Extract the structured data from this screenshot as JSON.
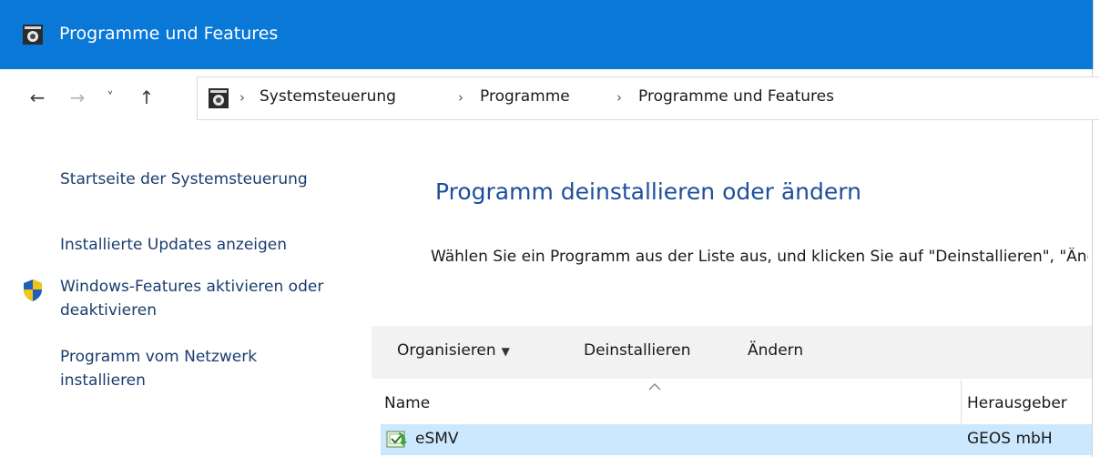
{
  "window": {
    "title": "Programme und Features"
  },
  "nav": {
    "back_glyph": "←",
    "forward_glyph": "→",
    "recent_glyph": "˅",
    "up_glyph": "↑",
    "separator": "›",
    "breadcrumbs": [
      "Systemsteuerung",
      "Programme",
      "Programme und Features"
    ]
  },
  "sidebar": {
    "links": [
      "Startseite der Systemsteuerung",
      "Installierte Updates anzeigen",
      "Windows-Features aktivieren oder deaktivieren",
      "Programm vom Netzwerk installieren"
    ]
  },
  "main": {
    "heading": "Programm deinstallieren oder ändern",
    "description": "Wählen Sie ein Programm aus der Liste aus, und klicken Sie auf \"Deinstallieren\", \"Ändern\" oder \"Reparieren\", um es zu deinstallieren."
  },
  "toolbar": {
    "organize": "Organisieren",
    "caret": "▼",
    "uninstall": "Deinstallieren",
    "change": "Ändern"
  },
  "columns": {
    "name": "Name",
    "publisher": "Herausgeber"
  },
  "rows": [
    {
      "name": "eSMV",
      "publisher": "GEOS mbH"
    }
  ],
  "colors": {
    "titlebar": "#0a78d7",
    "link": "#1a3c6e",
    "heading": "#1e4e9c",
    "toolbar_bg": "#f2f2f2",
    "selected_row": "#cce8ff"
  },
  "icons": {
    "title": "control-panel-icon",
    "address": "control-panel-icon",
    "shield": "uac-shield-icon",
    "row": "program-installer-icon",
    "sort": "sort-ascending-icon"
  }
}
